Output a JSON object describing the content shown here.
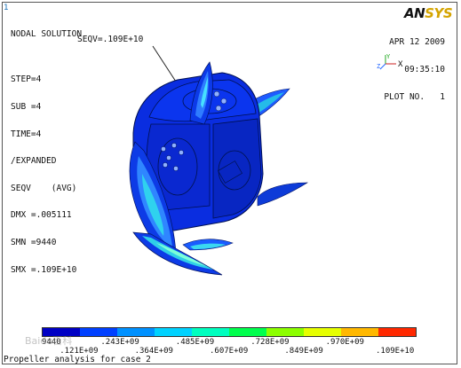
{
  "window": {
    "number": "1"
  },
  "info": {
    "lines": [
      "NODAL SOLUTION",
      "",
      "STEP=4",
      "SUB =4",
      "TIME=4",
      "/EXPANDED",
      "SEQV    (AVG)",
      "DMX =.005111",
      "SMN =9440",
      "SMX =.109E+10"
    ],
    "seqv_callout": "SEQV=.109E+10"
  },
  "brand": {
    "an": "AN",
    "sys": "SYS"
  },
  "plot_info": {
    "date": "APR 12 2009",
    "time": "09:35:10",
    "plot_no": "PLOT NO.   1"
  },
  "triad": {
    "y_label": "Y",
    "z_label": "Z",
    "x_label": "X"
  },
  "legend": {
    "colors": [
      "#0000c4",
      "#0040ff",
      "#0091ff",
      "#00d2ff",
      "#00ffbf",
      "#00ff4d",
      "#8cff00",
      "#e6ff00",
      "#ffb800",
      "#ff2800"
    ],
    "top_labels": [
      "9440",
      ".243E+09",
      ".485E+09",
      ".728E+09",
      ".970E+09"
    ],
    "bottom_labels": [
      ".121E+09",
      ".364E+09",
      ".607E+09",
      ".849E+09",
      ".109E+10"
    ]
  },
  "caption": "Propeller analysis for case 2",
  "watermark": "Baidu百科"
}
